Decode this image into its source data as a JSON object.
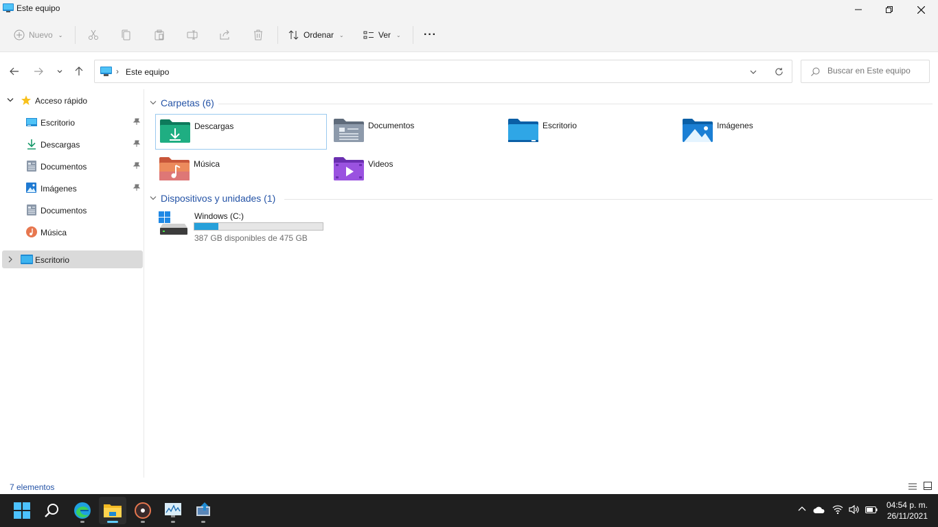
{
  "window": {
    "title": "Este equipo"
  },
  "toolbar": {
    "new_label": "Nuevo",
    "sort_label": "Ordenar",
    "view_label": "Ver",
    "more_label": "···"
  },
  "address": {
    "path": "Este equipo"
  },
  "search": {
    "placeholder": "Buscar en Este equipo"
  },
  "sidebar": {
    "quick_access": "Acceso rápido",
    "items": [
      {
        "label": "Escritorio",
        "pinned": true,
        "icon": "desktop-icon"
      },
      {
        "label": "Descargas",
        "pinned": true,
        "icon": "download-icon"
      },
      {
        "label": "Documentos",
        "pinned": true,
        "icon": "documents-icon"
      },
      {
        "label": "Imágenes",
        "pinned": true,
        "icon": "pictures-icon"
      },
      {
        "label": "Documentos",
        "pinned": false,
        "icon": "documents-icon"
      },
      {
        "label": "Música",
        "pinned": false,
        "icon": "music-icon"
      }
    ],
    "root_item": "Escritorio"
  },
  "folders": {
    "header": "Carpetas (6)",
    "items": [
      {
        "name": "Descargas",
        "icon": "downloads-folder-icon"
      },
      {
        "name": "Documentos",
        "icon": "documents-folder-icon"
      },
      {
        "name": "Escritorio",
        "icon": "desktop-folder-icon"
      },
      {
        "name": "Imágenes",
        "icon": "pictures-folder-icon"
      },
      {
        "name": "Música",
        "icon": "music-folder-icon"
      },
      {
        "name": "Videos",
        "icon": "videos-folder-icon"
      }
    ]
  },
  "devices": {
    "header": "Dispositivos y unidades (1)",
    "drive": {
      "name": "Windows (C:)",
      "info": "387 GB disponibles de 475 GB",
      "used_fraction": 0.185
    }
  },
  "status": {
    "count": "7 elementos"
  },
  "taskbar": {
    "time": "04:54 p. m.",
    "date": "26/11/2021"
  },
  "colors": {
    "accent": "#2453a6",
    "taskbar": "#1f1f1f",
    "drive_fill": "#26a0da"
  }
}
